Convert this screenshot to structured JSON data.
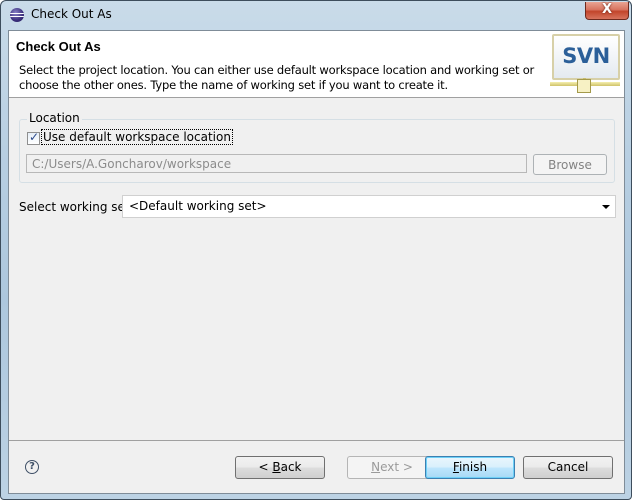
{
  "window": {
    "title": "Check Out As",
    "close_label": "X"
  },
  "banner": {
    "title": "Check Out As",
    "description": "Select the project location. You can either use default workspace location and working set or choose the other ones. Type the name of working set if you want to create it.",
    "logo_text": "SVN"
  },
  "location": {
    "group_label": "Location",
    "use_default_label": "Use default workspace location",
    "use_default_checked": true,
    "check_glyph": "✓",
    "path_value": "C:/Users/A.Goncharov/workspace",
    "browse_label": "Browse"
  },
  "working_set": {
    "label": "Select working set:",
    "selected": "<Default working set>"
  },
  "footer": {
    "help_glyph": "?",
    "back_prefix": "< ",
    "back_mnemonic": "B",
    "back_rest": "ack",
    "next_mnemonic": "N",
    "next_rest": "ext >",
    "finish_mnemonic": "F",
    "finish_rest": "inish",
    "cancel_label": "Cancel"
  }
}
